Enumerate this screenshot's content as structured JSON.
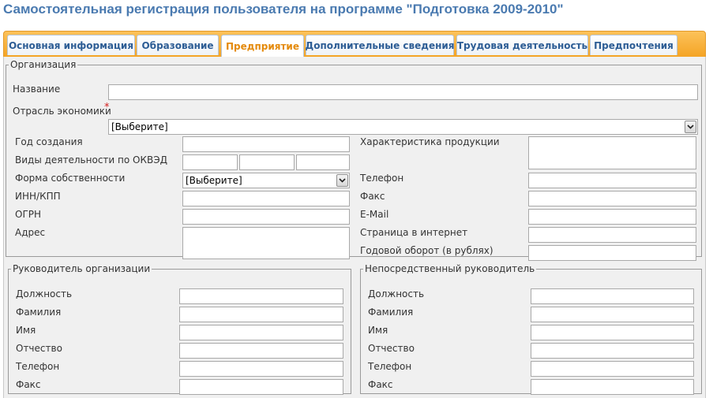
{
  "page": {
    "title": "Самостоятельная регистрация пользователя на программе \"Подготовка 2009-2010\""
  },
  "tabs": [
    {
      "label": "Основная информация"
    },
    {
      "label": "Образование"
    },
    {
      "label": "Предприятие"
    },
    {
      "label": "Дополнительные сведения"
    },
    {
      "label": "Трудовая деятельность"
    },
    {
      "label": "Предпочтения"
    }
  ],
  "organization": {
    "legend": "Организация",
    "name_label": "Название",
    "name_value": "",
    "industry_label": "Отрасль экономики",
    "required_mark": "*",
    "industry_value": "[Выберите]",
    "year_label": "Год создания",
    "okved_label": "Виды деятельности по ОКВЭД",
    "ownership_label": "Форма собственности",
    "ownership_value": "[Выберите]",
    "inn_label": "ИНН/КПП",
    "ogrn_label": "ОГРН",
    "address_label": "Адрес",
    "product_label": "Характеристика продукции",
    "phone_label": "Телефон",
    "fax_label": "Факс",
    "email_label": "E-Mail",
    "website_label": "Страница в интернет",
    "turnover_label": "Годовой оборот (в рублях)"
  },
  "head": {
    "legend": "Руководитель организации",
    "position_label": "Должность",
    "surname_label": "Фамилия",
    "firstname_label": "Имя",
    "patronymic_label": "Отчество",
    "phone_label": "Телефон",
    "fax_label": "Факс"
  },
  "supervisor": {
    "legend": "Непосредственный руководитель",
    "position_label": "Должность",
    "surname_label": "Фамилия",
    "firstname_label": "Имя",
    "patronymic_label": "Отчество",
    "phone_label": "Телефон",
    "fax_label": "Факс"
  },
  "colors": {
    "title": "#4a7ab0",
    "tab_text": "#2d5d95",
    "tab_active": "#e48a0c",
    "tabbar": "#f4a323",
    "panel": "#f0f0f0"
  },
  "icons": {
    "dropdown": "chevron-down-icon"
  }
}
